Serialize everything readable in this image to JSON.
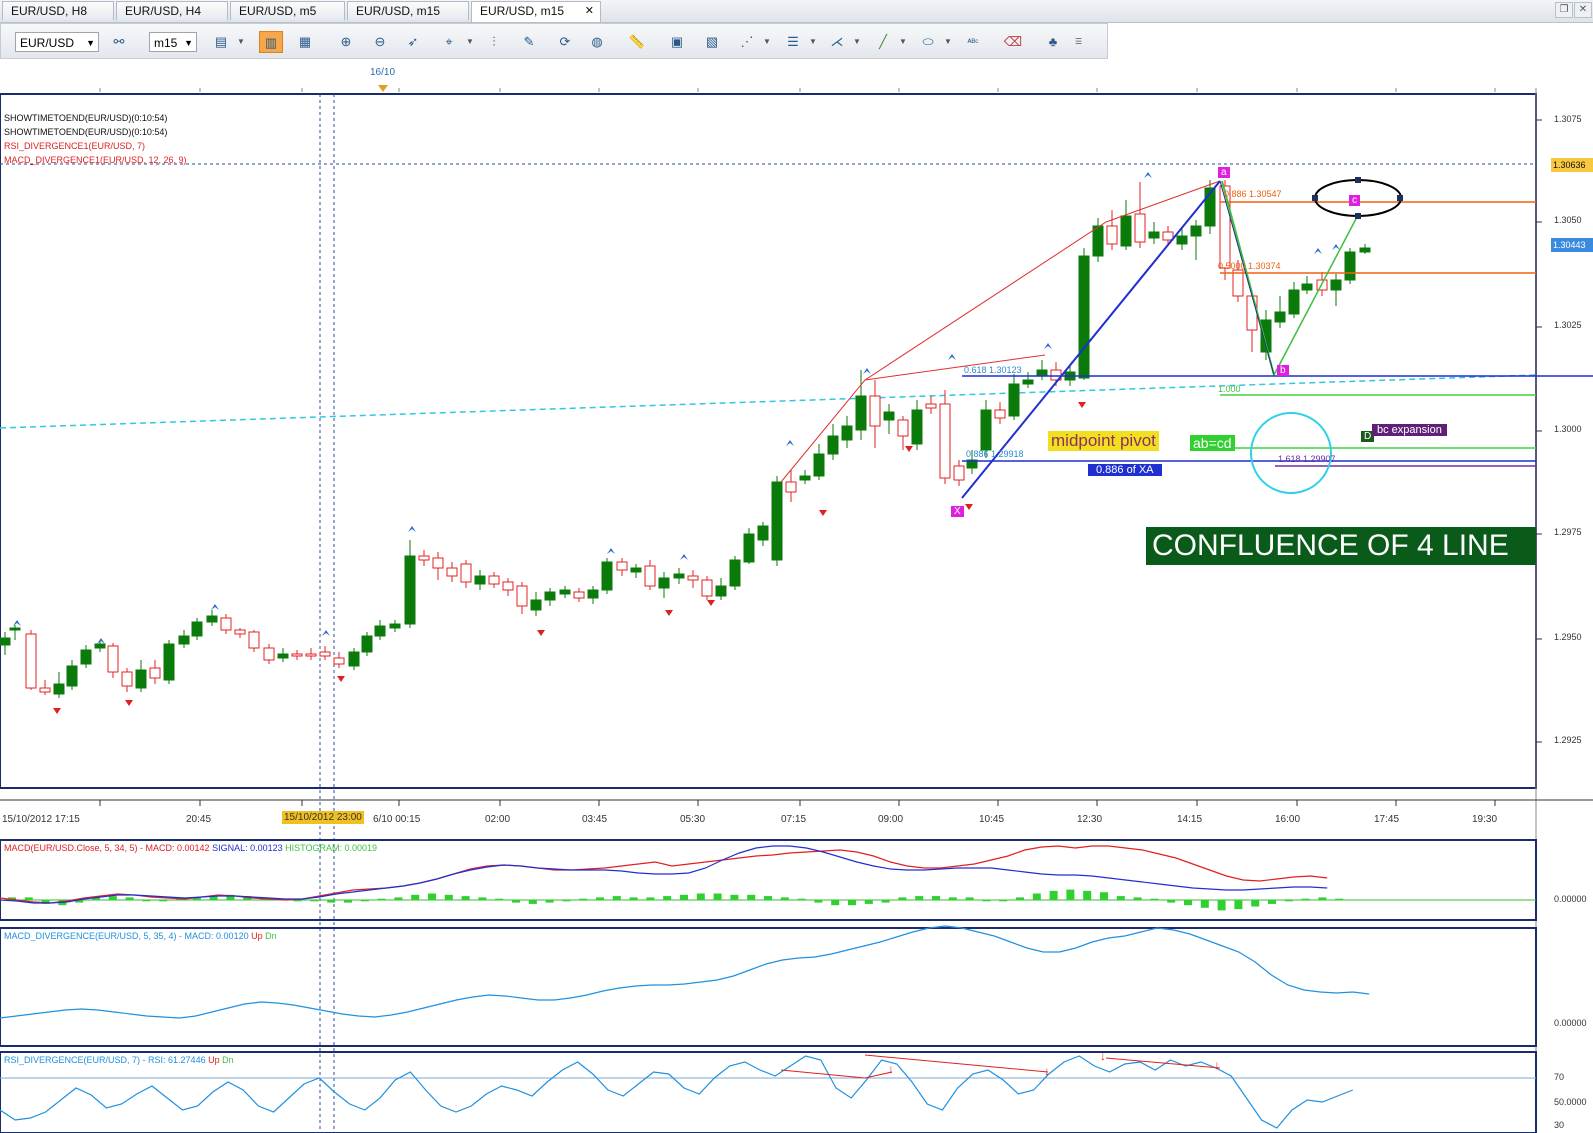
{
  "tabs": [
    {
      "label": "EUR/USD, H8"
    },
    {
      "label": "EUR/USD, H4"
    },
    {
      "label": "EUR/USD, m5"
    },
    {
      "label": "EUR/USD, m15"
    },
    {
      "label": "EUR/USD, m15",
      "close": "✕"
    }
  ],
  "toolbar": {
    "symbol": "EUR/USD",
    "timeframe": "m15"
  },
  "top_marker": "16/10",
  "indicator_labels": [
    "SHOWTIMETOEND(EUR/USD)(0:10:54)",
    "SHOWTIMETOEND(EUR/USD)(0:10:54)",
    "RSI_DIVERGENCE1(EUR/USD, 7)",
    "MACD_DIVERGENCE1(EUR/USD, 12, 26, 9)"
  ],
  "y_axis": [
    "1.3075",
    "1.3050",
    "1.3025",
    "1.3000",
    "1.2975",
    "1.2950",
    "1.2925"
  ],
  "price_boxes": {
    "high": "1.30636",
    "current": "1.30443"
  },
  "x_axis": [
    "15/10/2012 17:15",
    "20:45",
    "15/10/2012 23:00",
    "6/10 00:15",
    "02:00",
    "03:45",
    "05:30",
    "07:15",
    "09:00",
    "10:45",
    "12:30",
    "14:15",
    "16:00",
    "17:45",
    "19:30"
  ],
  "fib_labels": {
    "f886_top": "0.886 1.30547",
    "f500": "0.5000 1.30374",
    "f618": "0.618 1.30123",
    "f1000": "1.000",
    "f886_low": "0.886 1.29918",
    "f1618": "1.618 1.29907"
  },
  "points": {
    "x": "X",
    "a": "a",
    "b": "b",
    "c": "c",
    "d": "D"
  },
  "annotations": {
    "midpoint": "midpoint pivot",
    "abcd": "ab=cd",
    "xa886": "0.886 of XA",
    "bc_exp": "bc expansion",
    "confluence": "CONFLUENCE OF  4 LINE"
  },
  "macd_panel": {
    "label1": "MACD(EUR/USD.Close, 5, 34, 5) - ",
    "label2": "MACD: 0.00142",
    "label3": "SIGNAL: 0.00123",
    "label4": "HISTOGRAM: 0.00019",
    "zero": "0.00000"
  },
  "macd_div_panel": {
    "label1": "MACD_DIVERGENCE(EUR/USD, 5, 35, 4) - ",
    "label2": "MACD: 0.00120",
    "up": "Up",
    "dn": "Dn",
    "zero": "0.00000"
  },
  "rsi_panel": {
    "label1": "RSI_DIVERGENCE(EUR/USD, 7) - ",
    "label2": "RSI: 61.27446",
    "up": "Up",
    "dn": "Dn",
    "l70": "70",
    "l50": "50.0000",
    "l30": "30"
  },
  "colors": {
    "bull": "#0a7a0a",
    "bear": "#e02020",
    "pattern": "#1f2fd0",
    "fib": "#f06010",
    "cyan": "#30c8e0"
  }
}
